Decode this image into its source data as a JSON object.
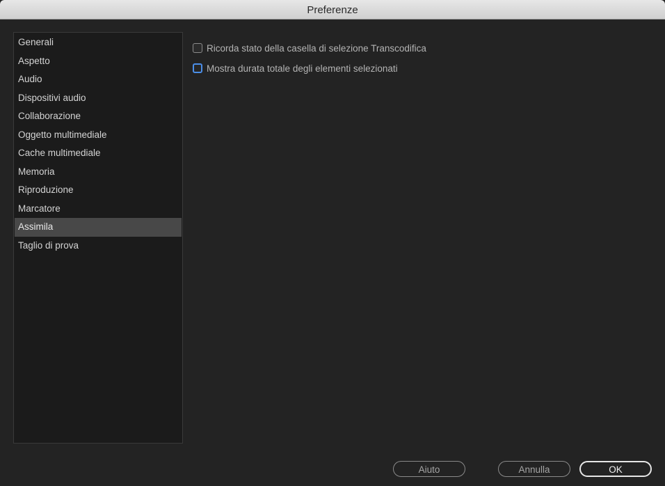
{
  "window": {
    "title": "Preferenze"
  },
  "sidebar": {
    "items": [
      {
        "label": "Generali",
        "selected": false
      },
      {
        "label": "Aspetto",
        "selected": false
      },
      {
        "label": "Audio",
        "selected": false
      },
      {
        "label": "Dispositivi audio",
        "selected": false
      },
      {
        "label": "Collaborazione",
        "selected": false
      },
      {
        "label": "Oggetto multimediale",
        "selected": false
      },
      {
        "label": "Cache multimediale",
        "selected": false
      },
      {
        "label": "Memoria",
        "selected": false
      },
      {
        "label": "Riproduzione",
        "selected": false
      },
      {
        "label": "Marcatore",
        "selected": false
      },
      {
        "label": "Assimila",
        "selected": true
      },
      {
        "label": "Taglio di prova",
        "selected": false
      }
    ]
  },
  "options": [
    {
      "label": "Ricorda stato della casella di selezione Transcodifica",
      "checked": false,
      "focused": false
    },
    {
      "label": "Mostra durata totale degli elementi selezionati",
      "checked": false,
      "focused": true
    }
  ],
  "buttons": {
    "help": "Aiuto",
    "cancel": "Annulla",
    "ok": "OK"
  },
  "colors": {
    "background": "#232323",
    "sidebar_background": "#1b1b1b",
    "selection": "#484848",
    "focus_ring": "#4b8ee8",
    "titlebar": "#d9d9d9"
  }
}
